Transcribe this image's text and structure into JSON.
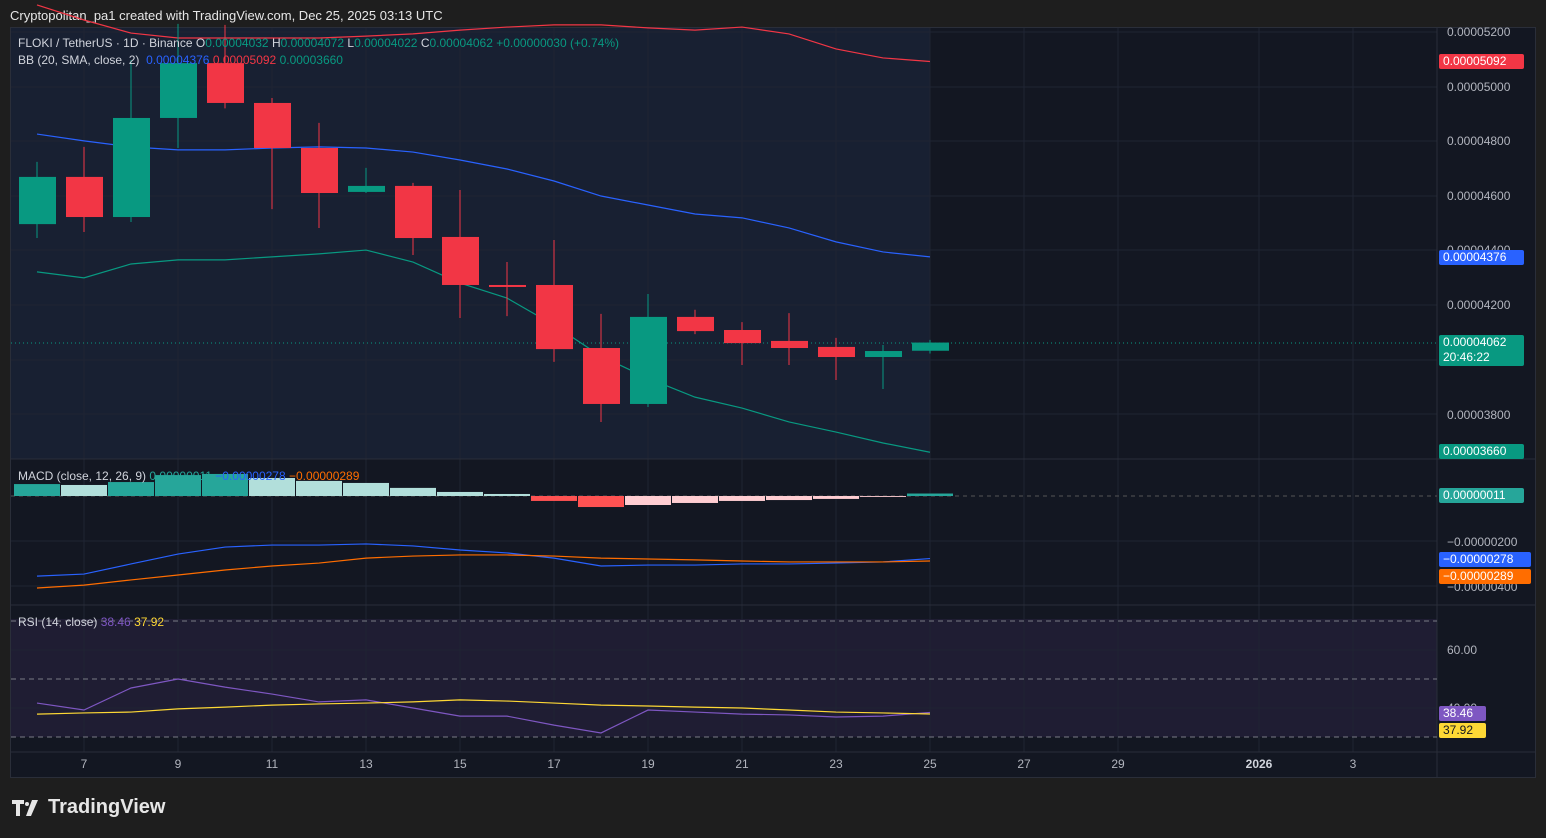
{
  "caption": "Cryptopolitan_pa1 created with TradingView.com, Dec 25, 2025 03:13 UTC",
  "legend": {
    "symbol": "FLOKI / TetherUS · 1D · Binance",
    "o_label": "O",
    "o": "0.00004032",
    "h_label": "H",
    "h": "0.00004072",
    "l_label": "L",
    "l": "0.00004022",
    "c_label": "C",
    "c": "0.00004062",
    "change": "+0.00000030 (+0.74%)",
    "bb": "BB (20, SMA, close, 2)",
    "bb_basis": "0.00004376",
    "bb_upper": "0.00005092",
    "bb_lower": "0.00003660",
    "macd": "MACD (close, 12, 26, 9)",
    "macd_hist": "0.00000011",
    "macd_line": "−0.00000278",
    "macd_signal": "−0.00000289",
    "rsi": "RSI (14, close)",
    "rsi_val": "38.46",
    "rsi_ma": "37.92"
  },
  "price_axis": [
    "0.00005200",
    "0.00005000",
    "0.00004800",
    "0.00004600",
    "0.00004400",
    "0.00004200",
    "0.00003800"
  ],
  "macd_axis": [
    "−0.00000200",
    "−0.00000400"
  ],
  "rsi_axis": [
    "60.00",
    "40.00"
  ],
  "axis_labels": {
    "upper": "0.00005092",
    "basis": "0.00004376",
    "last": "0.00004062",
    "countdown": "20:46:22",
    "lower": "0.00003660",
    "hist": "0.00000011",
    "macd": "−0.00000278",
    "signal": "−0.00000289",
    "rsi": "38.46",
    "rsi_ma": "37.92"
  },
  "time_axis": [
    {
      "d": 7,
      "t": "7"
    },
    {
      "d": 9,
      "t": "9"
    },
    {
      "d": 11,
      "t": "11"
    },
    {
      "d": 13,
      "t": "13"
    },
    {
      "d": 15,
      "t": "15"
    },
    {
      "d": 17,
      "t": "17"
    },
    {
      "d": 19,
      "t": "19"
    },
    {
      "d": 21,
      "t": "21"
    },
    {
      "d": 23,
      "t": "23"
    },
    {
      "d": 25,
      "t": "25"
    },
    {
      "d": 27,
      "t": "27"
    },
    {
      "d": 29,
      "t": "29"
    },
    {
      "d": 32,
      "t": "2026"
    },
    {
      "d": 34,
      "t": "3"
    }
  ],
  "logo": "TradingView",
  "colors": {
    "up": "#089981",
    "down": "#f23645",
    "basis": "#2962ff",
    "upper": "#f23645",
    "lower": "#089981",
    "macd": "#2962ff",
    "signal": "#ff6d00",
    "rsi": "#7e57c2",
    "rsi_ma": "#fdd835"
  },
  "chart_data": {
    "type": "candlestick",
    "title": "FLOKI / TetherUS 1D Binance",
    "days": [
      6,
      7,
      8,
      9,
      10,
      11,
      12,
      13,
      14,
      15,
      16,
      17,
      18,
      19,
      20,
      21,
      22,
      23,
      24,
      25
    ],
    "ohlc_e6": [
      [
        44.96,
        47.24,
        44.45,
        46.69
      ],
      [
        46.69,
        47.79,
        44.67,
        45.22
      ],
      [
        45.22,
        50.97,
        45.04,
        48.85
      ],
      [
        48.85,
        52.3,
        47.75,
        50.86
      ],
      [
        50.86,
        52.26,
        49.2,
        49.4
      ],
      [
        49.4,
        49.58,
        45.51,
        47.75
      ],
      [
        47.75,
        48.67,
        44.82,
        46.1
      ],
      [
        46.14,
        47.02,
        46.1,
        46.36
      ],
      [
        46.36,
        46.47,
        43.83,
        44.45
      ],
      [
        44.49,
        46.21,
        41.52,
        42.73
      ],
      [
        42.73,
        43.57,
        41.59,
        42.7
      ],
      [
        42.73,
        44.38,
        39.91,
        40.38
      ],
      [
        40.42,
        41.67,
        37.71,
        38.37
      ],
      [
        38.37,
        42.4,
        38.26,
        41.56
      ],
      [
        41.56,
        41.82,
        40.93,
        41.04
      ],
      [
        41.08,
        41.37,
        39.8,
        40.6
      ],
      [
        40.68,
        41.7,
        39.8,
        40.42
      ],
      [
        40.46,
        40.79,
        39.25,
        40.09
      ],
      [
        40.09,
        40.53,
        38.92,
        40.31
      ],
      [
        40.32,
        40.72,
        40.22,
        40.62
      ]
    ],
    "bb_basis_e6": [
      48.26,
      48.01,
      47.79,
      47.68,
      47.68,
      47.75,
      47.79,
      47.75,
      47.6,
      47.31,
      46.98,
      46.54,
      45.99,
      45.66,
      45.33,
      45.19,
      44.82,
      44.31,
      43.94,
      43.76
    ],
    "bb_upper_e6": [
      52.99,
      52.44,
      51.96,
      51.78,
      51.78,
      51.78,
      51.78,
      51.85,
      51.93,
      52.07,
      52.18,
      52.26,
      52.26,
      52.15,
      52.07,
      52.18,
      51.93,
      51.38,
      51.05,
      50.92
    ],
    "bb_lower_e6": [
      43.21,
      42.99,
      43.5,
      43.65,
      43.65,
      43.76,
      43.87,
      44.01,
      43.57,
      42.8,
      42.25,
      41.26,
      40.12,
      39.31,
      38.62,
      38.22,
      37.71,
      37.34,
      36.94,
      36.6
    ],
    "macd_hist_e6": [
      0.53,
      0.49,
      0.62,
      0.93,
      0.98,
      0.8,
      0.67,
      0.58,
      0.36,
      0.18,
      0.09,
      -0.22,
      -0.49,
      -0.4,
      -0.31,
      -0.22,
      -0.18,
      -0.13,
      -0.04,
      0.11
    ],
    "macd_e6": [
      -3.56,
      -3.47,
      -3.02,
      -2.58,
      -2.27,
      -2.18,
      -2.18,
      -2.13,
      -2.22,
      -2.4,
      -2.53,
      -2.76,
      -3.11,
      -3.07,
      -3.07,
      -3.02,
      -3.02,
      -2.98,
      -2.93,
      -2.78
    ],
    "signal_e6": [
      -4.09,
      -3.96,
      -3.73,
      -3.51,
      -3.29,
      -3.11,
      -2.98,
      -2.76,
      -2.67,
      -2.62,
      -2.62,
      -2.67,
      -2.76,
      -2.8,
      -2.84,
      -2.89,
      -2.93,
      -2.93,
      -2.93,
      -2.89
    ],
    "rsi": [
      41.7,
      39.3,
      46.9,
      50.0,
      47.2,
      44.8,
      42.1,
      42.8,
      40.0,
      37.2,
      37.2,
      34.1,
      31.4,
      39.3,
      38.6,
      37.9,
      37.6,
      36.9,
      37.2,
      38.46
    ],
    "rsi_ma": [
      37.9,
      38.3,
      38.6,
      39.7,
      40.3,
      41.0,
      41.4,
      41.7,
      42.1,
      42.8,
      42.4,
      41.7,
      41.0,
      40.7,
      40.3,
      40.0,
      39.3,
      38.6,
      38.3,
      37.92
    ],
    "rsi_levels": [
      70,
      50,
      30
    ]
  }
}
